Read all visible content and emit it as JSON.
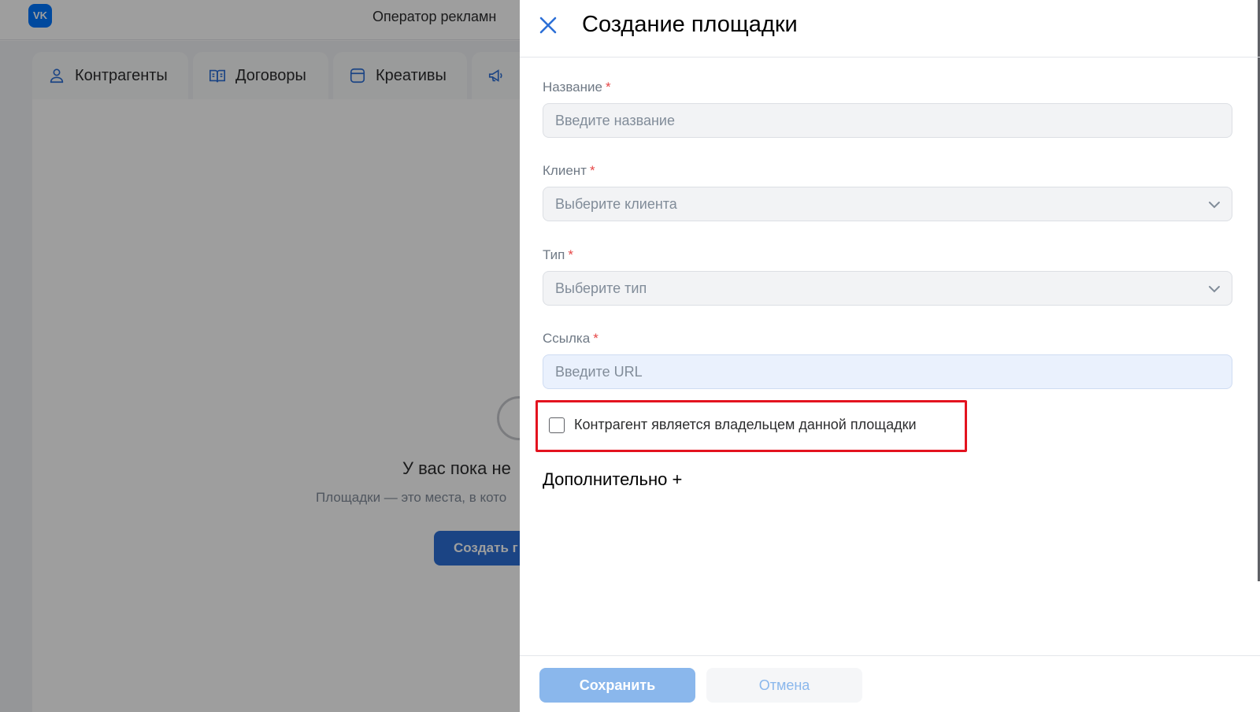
{
  "app": {
    "title": "Оператор рекламн",
    "logo_icon": "vk-logo-icon",
    "logo_text": "VK"
  },
  "nav_tabs": [
    {
      "label": "Контрагенты",
      "icon": "user-icon"
    },
    {
      "label": "Договоры",
      "icon": "book-icon"
    },
    {
      "label": "Креативы",
      "icon": "card-icon"
    },
    {
      "label": "",
      "icon": "megaphone-icon"
    }
  ],
  "empty_state": {
    "icon": "info-circle-icon",
    "title": "У вас пока не",
    "description": "Площадки — это места, в кото",
    "create_button_label": "Создать г"
  },
  "drawer": {
    "title": "Создание площадки",
    "close_icon": "close-icon",
    "fields": {
      "name": {
        "label": "Название",
        "required_mark": "*",
        "placeholder": "Введите название",
        "value": ""
      },
      "client": {
        "label": "Клиент",
        "required_mark": "*",
        "placeholder": "Выберите клиента"
      },
      "type": {
        "label": "Тип",
        "required_mark": "*",
        "placeholder": "Выберите тип"
      },
      "link": {
        "label": "Ссылка",
        "required_mark": "*",
        "placeholder": "Введите URL",
        "value": ""
      }
    },
    "owner_checkbox": {
      "label": "Контрагент является владельцем данной площадки",
      "checked": false
    },
    "extra_toggle_label": "Дополнительно +",
    "footer": {
      "save_label": "Сохранить",
      "cancel_label": "Отмена"
    }
  },
  "colors": {
    "accent": "#0077ff",
    "primary_button": "#2c6fd6",
    "save_button_disabled": "#8ab7ec",
    "highlight": "#e3131f",
    "required_mark": "#e64646"
  }
}
